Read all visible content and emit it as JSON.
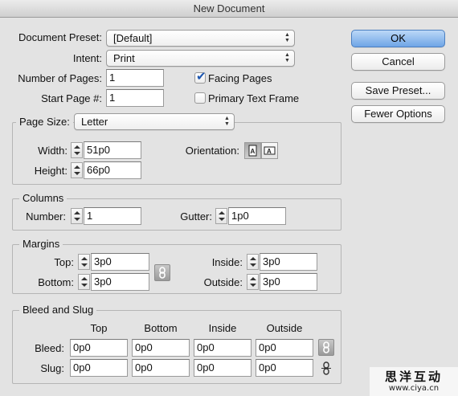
{
  "window": {
    "title": "New Document"
  },
  "top": {
    "preset_label": "Document Preset:",
    "preset_value": "[Default]",
    "intent_label": "Intent:",
    "intent_value": "Print",
    "pages_label": "Number of Pages:",
    "pages_value": "1",
    "start_label": "Start Page #:",
    "start_value": "1",
    "facing_label": "Facing Pages",
    "facing_checked": true,
    "primary_label": "Primary Text Frame",
    "primary_checked": false
  },
  "buttons": {
    "ok": "OK",
    "cancel": "Cancel",
    "save_preset": "Save Preset...",
    "fewer_options": "Fewer Options"
  },
  "page_size": {
    "label": "Page Size:",
    "value": "Letter",
    "width_label": "Width:",
    "width_value": "51p0",
    "height_label": "Height:",
    "height_value": "66p0",
    "orientation_label": "Orientation:",
    "orientation_selected": "portrait"
  },
  "columns": {
    "title": "Columns",
    "number_label": "Number:",
    "number_value": "1",
    "gutter_label": "Gutter:",
    "gutter_value": "1p0"
  },
  "margins": {
    "title": "Margins",
    "top_label": "Top:",
    "top_value": "3p0",
    "bottom_label": "Bottom:",
    "bottom_value": "3p0",
    "inside_label": "Inside:",
    "inside_value": "3p0",
    "outside_label": "Outside:",
    "outside_value": "3p0"
  },
  "bleed": {
    "title": "Bleed and Slug",
    "col_top": "Top",
    "col_bottom": "Bottom",
    "col_inside": "Inside",
    "col_outside": "Outside",
    "bleed_label": "Bleed:",
    "slug_label": "Slug:",
    "bleed_values": [
      "0p0",
      "0p0",
      "0p0",
      "0p0"
    ],
    "slug_values": [
      "0p0",
      "0p0",
      "0p0",
      "0p0"
    ]
  },
  "watermark": {
    "text": "思洋互动",
    "url": "www.ciya.cn"
  },
  "icons": {
    "popup_arrows": "up-down-arrows-icon",
    "link": "chain-link-icon",
    "orientation_portrait": "portrait-icon",
    "orientation_landscape": "landscape-icon"
  }
}
